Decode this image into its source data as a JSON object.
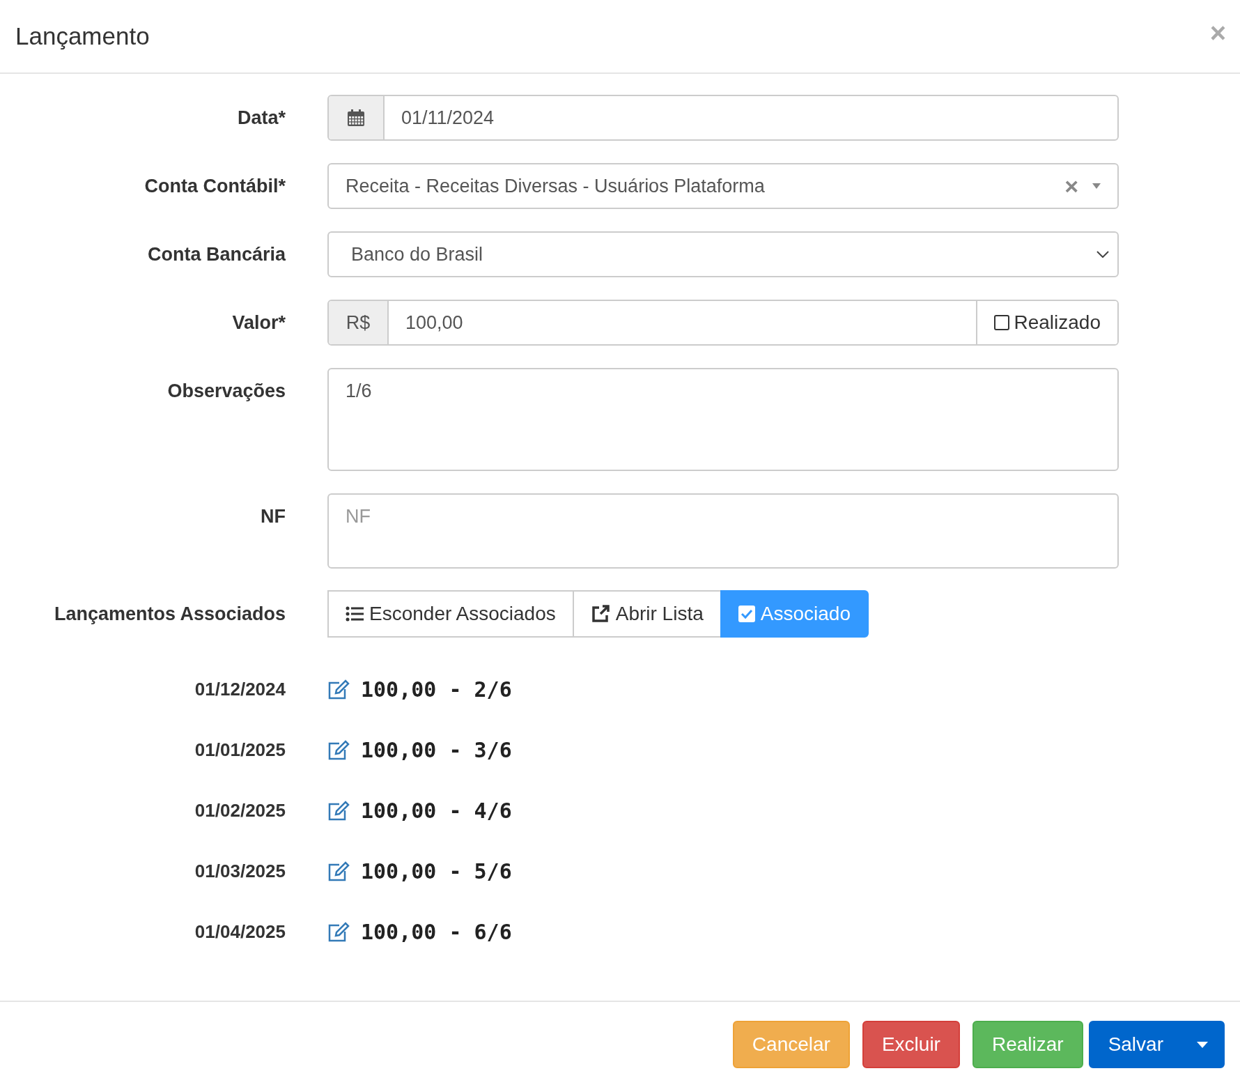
{
  "modal": {
    "title": "Lançamento",
    "close": "×"
  },
  "fields": [
    {
      "kind": "date",
      "label": "Data*",
      "value": "01/11/2024"
    },
    {
      "kind": "select2",
      "label": "Conta Contábil*",
      "value": "Receita - Receitas Diversas - Usuários Plataforma",
      "clear": "×"
    },
    {
      "kind": "select",
      "label": "Conta Bancária",
      "value": "Banco do Brasil"
    },
    {
      "kind": "money",
      "label": "Valor*",
      "prefix": "R$",
      "value": "100,00",
      "check_label": "Realizado",
      "checked": false
    },
    {
      "kind": "textarea",
      "label": "Observações",
      "value": "1/6"
    },
    {
      "kind": "nf",
      "label": "NF",
      "placeholder": "NF"
    }
  ],
  "associados": {
    "label": "Lançamentos Associados",
    "buttons": [
      {
        "kind": "list",
        "label": "Esconder Associados",
        "selected": false
      },
      {
        "kind": "external",
        "label": "Abrir Lista",
        "selected": false
      },
      {
        "kind": "check",
        "label": "Associado",
        "selected": true
      }
    ],
    "rows": [
      {
        "date": "01/12/2024",
        "text": "100,00 - 2/6"
      },
      {
        "date": "01/01/2025",
        "text": "100,00 - 3/6"
      },
      {
        "date": "01/02/2025",
        "text": "100,00 - 4/6"
      },
      {
        "date": "01/03/2025",
        "text": "100,00 - 5/6"
      },
      {
        "date": "01/04/2025",
        "text": "100,00 - 6/6"
      }
    ]
  },
  "footer": [
    {
      "kind": "warning",
      "label": "Cancelar"
    },
    {
      "kind": "danger",
      "label": "Excluir"
    },
    {
      "kind": "success",
      "label": "Realizar"
    },
    {
      "kind": "primary-split",
      "label": "Salvar"
    }
  ]
}
